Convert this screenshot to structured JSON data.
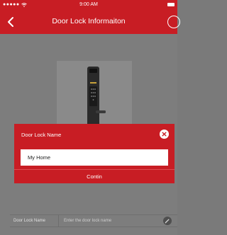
{
  "status_bar": {
    "signal": "●●●●●",
    "time": "9:00 AM"
  },
  "nav": {
    "title": "Door Lock Informaiton"
  },
  "info_row": {
    "label": "Door Lock Name",
    "placeholder": "Enter the door lock name"
  },
  "modal": {
    "title": "Door Lock Name",
    "input_value": "My Home",
    "confirm_label": "Contin"
  },
  "colors": {
    "accent": "#c81d24",
    "overlay": "#7d7d7d"
  },
  "icons": {
    "back": "chevron-left-icon",
    "edit": "edit-circle-icon",
    "close": "close-circle-icon",
    "pencil": "pencil-icon",
    "wifi": "wifi-icon",
    "battery": "battery-icon"
  }
}
